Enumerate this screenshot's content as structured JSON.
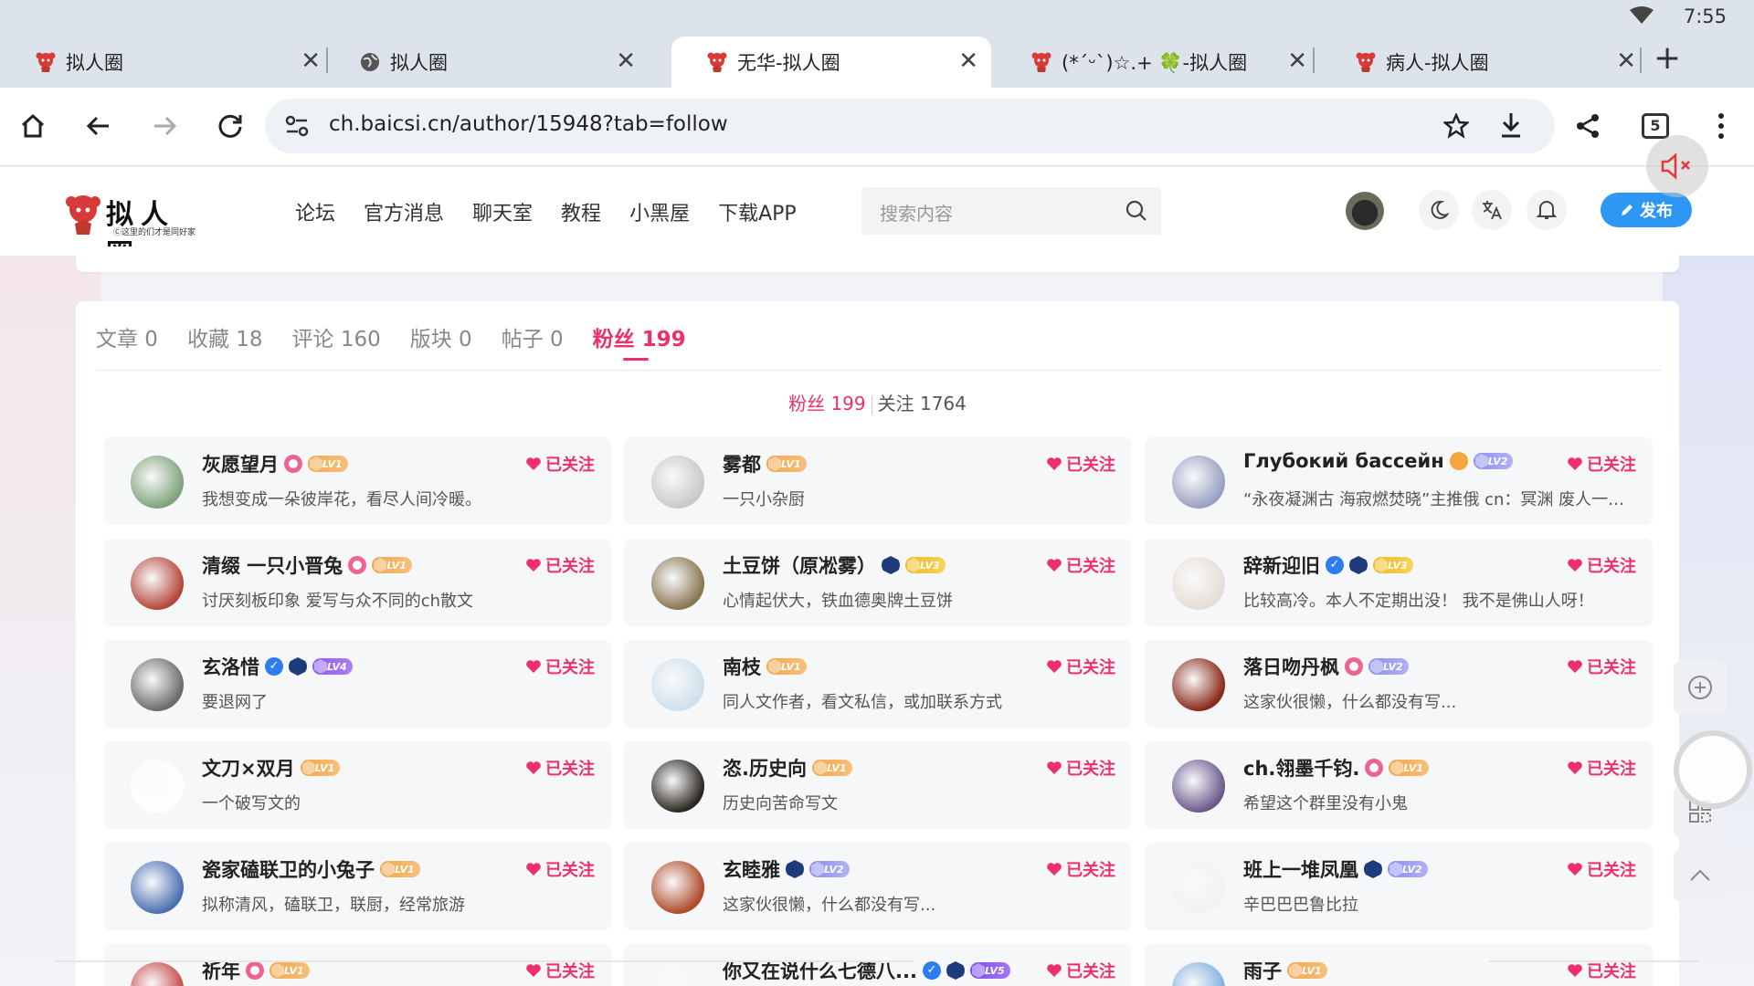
{
  "status": {
    "time": "7:55"
  },
  "browser": {
    "tabs": [
      {
        "title": "拟人圈",
        "favicon": "site-favicon-icon"
      },
      {
        "title": "拟人圈",
        "favicon": "globe-icon"
      },
      {
        "title": "无华-拟人圈",
        "favicon": "site-favicon-icon",
        "active": true
      },
      {
        "title": "(*ˊᵕˋ)☆.+ 🍀-拟人圈",
        "favicon": "site-favicon-icon"
      },
      {
        "title": "病人-拟人圈",
        "favicon": "site-favicon-icon"
      }
    ],
    "url": "ch.baicsi.cn/author/15948?tab=follow",
    "tab_count": "5"
  },
  "site": {
    "logo_title": "拟人圈",
    "logo_sub": "Ⓒ这里的们才是同好家",
    "nav": [
      "论坛",
      "官方消息",
      "聊天室",
      "教程",
      "小黑屋",
      "下载APP"
    ],
    "search_placeholder": "搜索内容",
    "publish_label": "发布"
  },
  "profile": {
    "tabs": [
      {
        "label": "文章 0"
      },
      {
        "label": "收藏 18"
      },
      {
        "label": "评论 160"
      },
      {
        "label": "版块 0"
      },
      {
        "label": "帖子 0"
      },
      {
        "label": "粉丝 199",
        "active": true
      }
    ],
    "subtab_fans": "粉丝 199",
    "subtab_follow": "关注 1764",
    "follow_label": "已关注",
    "users": [
      {
        "name": "灰愿望月",
        "level": "LV1",
        "icons": [
          "pink"
        ],
        "bio": "我想变成一朵彼岸花，看尽人间冷暖。",
        "avatar": "#7fa37a"
      },
      {
        "name": "雾都",
        "level": "LV1",
        "icons": [],
        "bio": "一只小杂厨",
        "avatar": "#c9c9c9"
      },
      {
        "name": "Глубокий бассейн",
        "level": "LV2",
        "icons": [
          "orange"
        ],
        "bio": "“永夜凝渊古 海寂燃焚晓”主推俄 cn：冥渊 废人一个 上学党 喜欢的东西很多 天天熬夜",
        "avatar": "#9aa0c0"
      },
      {
        "name": "清缀 一只小晋兔",
        "level": "LV1",
        "icons": [
          "pink"
        ],
        "bio": "讨厌刻板印象 爱写与众不同的ch散文",
        "avatar": "#b6463a"
      },
      {
        "name": "土豆饼（原凇雾）",
        "level": "LV3",
        "icons": [
          "navy"
        ],
        "bio": "心情起伏大，铁血德奥牌土豆饼",
        "avatar": "#8a7650"
      },
      {
        "name": "辞新迎旧",
        "level": "LV3",
        "icons": [
          "blue",
          "navy"
        ],
        "bio": "比较高冷。本人不定期出没！ 我不是佛山人呀！",
        "avatar": "#e7ddd6"
      },
      {
        "name": "玄洛惜",
        "level": "LV4",
        "icons": [
          "blue",
          "navy"
        ],
        "bio": "要退网了",
        "avatar": "#6b6b6b"
      },
      {
        "name": "南枝",
        "level": "LV1",
        "icons": [],
        "bio": "同人文作者，看文私信，或加联系方式",
        "avatar": "#cfe0ec"
      },
      {
        "name": "落日吻丹枫",
        "level": "LV2",
        "icons": [
          "pink"
        ],
        "bio": "这家伙很懒，什么都没有写...",
        "avatar": "#8a2a1a"
      },
      {
        "name": "文刀×双月",
        "level": "LV1",
        "icons": [],
        "bio": "一个破写文的",
        "avatar": "#ffffff"
      },
      {
        "name": "恣.历史向",
        "level": "LV1",
        "icons": [],
        "bio": "历史向苦命写文",
        "avatar": "#2a2622"
      },
      {
        "name": "ch.翎墨千钧.",
        "level": "LV1",
        "icons": [
          "pink"
        ],
        "bio": "希望这个群里没有小鬼",
        "avatar": "#6a5a8a"
      },
      {
        "name": "瓷家磕联卫的小兔子",
        "level": "LV1",
        "icons": [],
        "bio": "拟称清风，磕联卫，联厨，经常旅游",
        "avatar": "#4a70b0"
      },
      {
        "name": "玄睦雅",
        "level": "LV2",
        "icons": [
          "navy"
        ],
        "bio": "这家伙很懒，什么都没有写...",
        "avatar": "#b04a2a"
      },
      {
        "name": "班上一堆凤凰",
        "level": "LV2",
        "icons": [
          "navy"
        ],
        "bio": "辛巴巴巴鲁比拉",
        "avatar": "#f2f2f2"
      },
      {
        "name": "祈年",
        "level": "LV1",
        "icons": [
          "pink"
        ],
        "bio": "",
        "avatar": "#c84a4a"
      },
      {
        "name": "你又在说什么七德八...",
        "level": "LV5",
        "icons": [
          "blue",
          "navy"
        ],
        "bio": "",
        "avatar": "#f5f5f5"
      },
      {
        "name": "雨子",
        "level": "LV1",
        "icons": [],
        "bio": "",
        "avatar": "#7fb0e0"
      }
    ]
  }
}
